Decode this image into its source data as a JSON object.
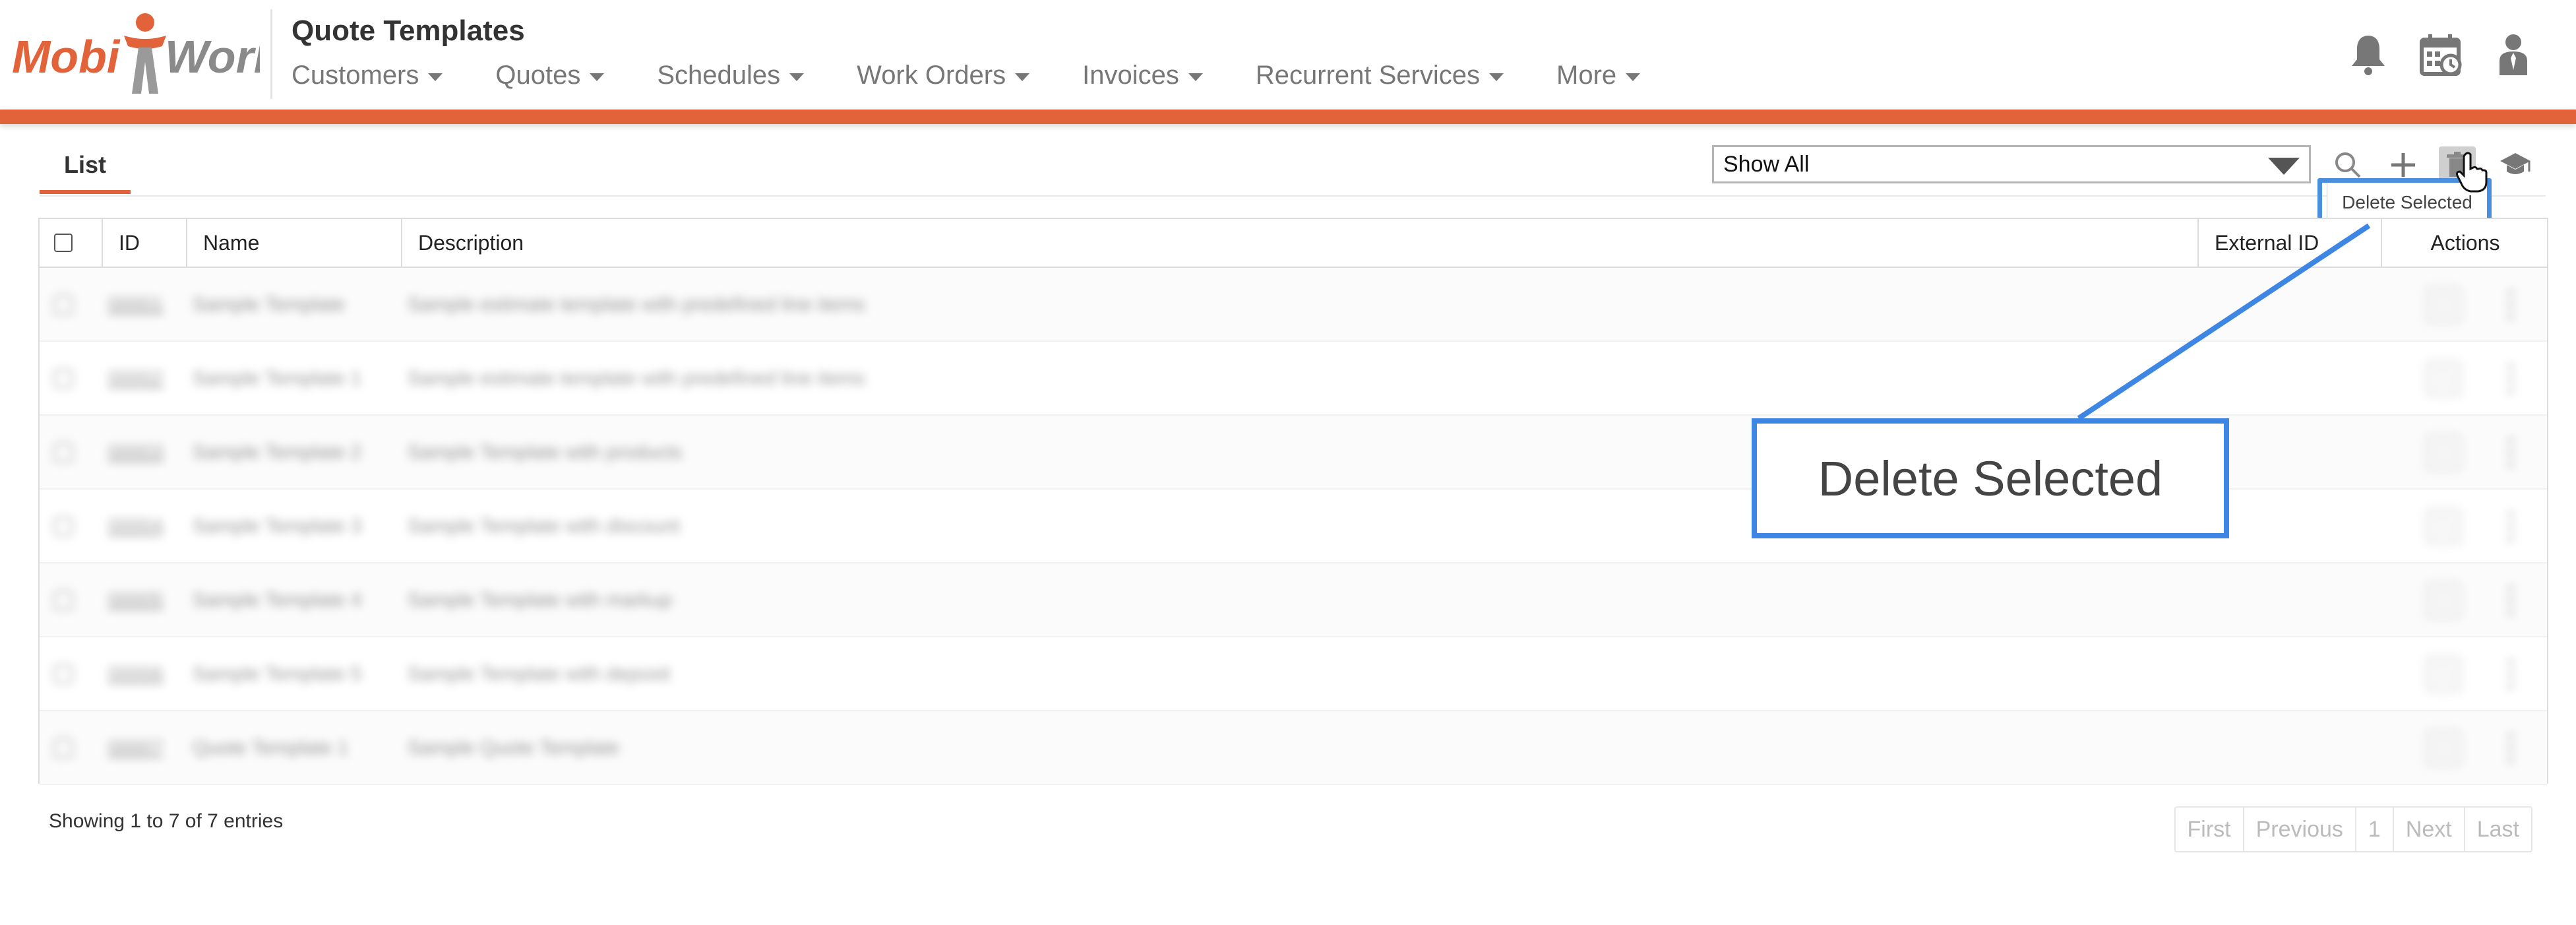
{
  "app": {
    "logo_text_left": "Mobi",
    "logo_text_right": "Work",
    "page_title": "Quote Templates"
  },
  "nav": {
    "items": [
      {
        "label": "Customers"
      },
      {
        "label": "Quotes"
      },
      {
        "label": "Schedules"
      },
      {
        "label": "Work Orders"
      },
      {
        "label": "Invoices"
      },
      {
        "label": "Recurrent Services"
      },
      {
        "label": "More"
      }
    ]
  },
  "header_icons": [
    "bell-icon",
    "calendar-icon",
    "user-icon"
  ],
  "tabs": {
    "list_label": "List"
  },
  "toolbar": {
    "filter_value": "Show All",
    "icons": [
      "search-icon",
      "plus-icon",
      "trash-icon",
      "graduation-cap-icon"
    ],
    "tooltip": "Delete Selected"
  },
  "table": {
    "columns": {
      "id": "ID",
      "name": "Name",
      "description": "Description",
      "external_id": "External ID",
      "actions": "Actions"
    },
    "rows": [
      {
        "id": "00001",
        "name": "Sample Template",
        "description": "Sample estimate template with predefined line items"
      },
      {
        "id": "00002",
        "name": "Sample Template 1",
        "description": "Sample estimate template with predefined line items"
      },
      {
        "id": "00003",
        "name": "Sample Template 2",
        "description": "Sample Template with products"
      },
      {
        "id": "00004",
        "name": "Sample Template 3",
        "description": "Sample Template with discount"
      },
      {
        "id": "00005",
        "name": "Sample Template 4",
        "description": "Sample Template with markup"
      },
      {
        "id": "00006",
        "name": "Sample Template 5",
        "description": "Sample Template with deposit"
      },
      {
        "id": "00007",
        "name": "Quote Template 1",
        "description": "Sample Quote Template"
      }
    ]
  },
  "footer": {
    "info": "Showing 1 to 7 of 7 entries",
    "pager": [
      "First",
      "Previous",
      "1",
      "Next",
      "Last"
    ]
  },
  "callout": {
    "label": "Delete Selected"
  },
  "colors": {
    "brand_orange": "#e2623a",
    "callout_blue": "#3e86e4"
  }
}
